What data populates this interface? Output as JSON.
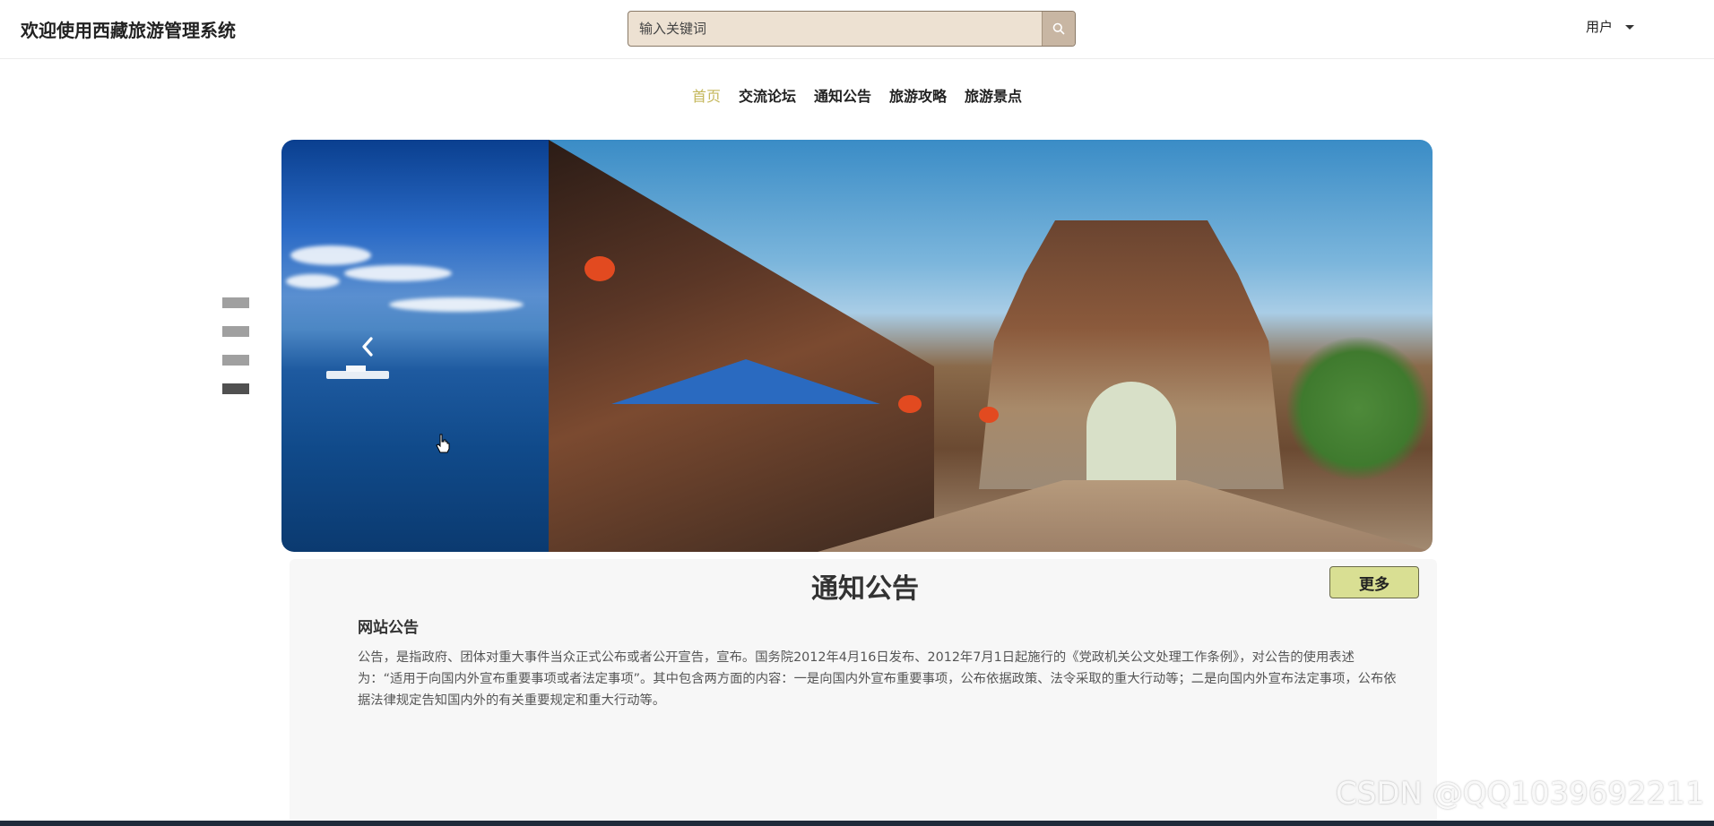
{
  "header": {
    "site_title": "欢迎使用西藏旅游管理系统",
    "search": {
      "placeholder": "输入关键词",
      "button_icon": "search-icon"
    },
    "user_menu": {
      "label": "用户",
      "icon": "caret-down-icon"
    }
  },
  "nav": {
    "items": [
      {
        "label": "首页",
        "active": true
      },
      {
        "label": "交流论坛",
        "active": false
      },
      {
        "label": "通知公告",
        "active": false
      },
      {
        "label": "旅游攻略",
        "active": false
      },
      {
        "label": "旅游景点",
        "active": false
      }
    ],
    "active_color": "#c4b75b"
  },
  "carousel": {
    "slide_count": 4,
    "active_index": 3,
    "prev_icon": "chevron-left-icon"
  },
  "notice": {
    "title": "通知公告",
    "more_label": "更多",
    "more_color": "#d9df93",
    "item_title": "网站公告",
    "item_body": "公告，是指政府、团体对重大事件当众正式公布或者公开宣告，宣布。国务院2012年4月16日发布、2012年7月1日起施行的《党政机关公文处理工作条例》，对公告的使用表述为：“适用于向国内外宣布重要事项或者法定事项”。其中包含两方面的内容：一是向国内外宣布重要事项，公布依据政策、法令采取的重大行动等；二是向国内外宣布法定事项，公布依据法律规定告知国内外的有关重要规定和重大行动等。"
  },
  "watermark": "CSDN @QQ1039692211"
}
